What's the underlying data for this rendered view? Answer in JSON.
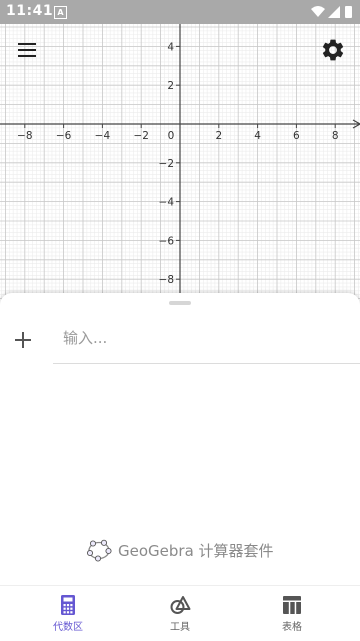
{
  "status_bar": {
    "time": "11:41",
    "indicator": "A"
  },
  "graph": {
    "x_tick_labels": [
      "−8",
      "−6",
      "−4",
      "−2",
      "0",
      "2",
      "4",
      "6",
      "8"
    ],
    "y_tick_labels": [
      "4",
      "2",
      "−2",
      "−4",
      "−6",
      "−8"
    ],
    "x_ticks": [
      -8,
      -6,
      -4,
      -2,
      2,
      4,
      6,
      8
    ],
    "y_ticks": [
      4,
      2,
      -2,
      -4,
      -6,
      -8
    ],
    "major_grid_color": "#c8c8c8",
    "minor_grid_color": "#ececec",
    "axis_color": "#444444"
  },
  "toolbar": {
    "menu_icon": "hamburger-menu-icon",
    "settings_icon": "gear-icon"
  },
  "algebra": {
    "input_placeholder": "输入...",
    "add_icon": "plus-icon"
  },
  "branding": {
    "text": "GeoGebra 计算器套件",
    "logo_icon": "geogebra-logo-icon"
  },
  "bottom_nav": [
    {
      "label": "代数区",
      "icon": "calculator-icon",
      "active": true
    },
    {
      "label": "工具",
      "icon": "shapes-tools-icon",
      "active": false
    },
    {
      "label": "表格",
      "icon": "table-icon",
      "active": false
    }
  ],
  "colors": {
    "accent": "#6557d2",
    "inactive_icon": "#555555"
  }
}
